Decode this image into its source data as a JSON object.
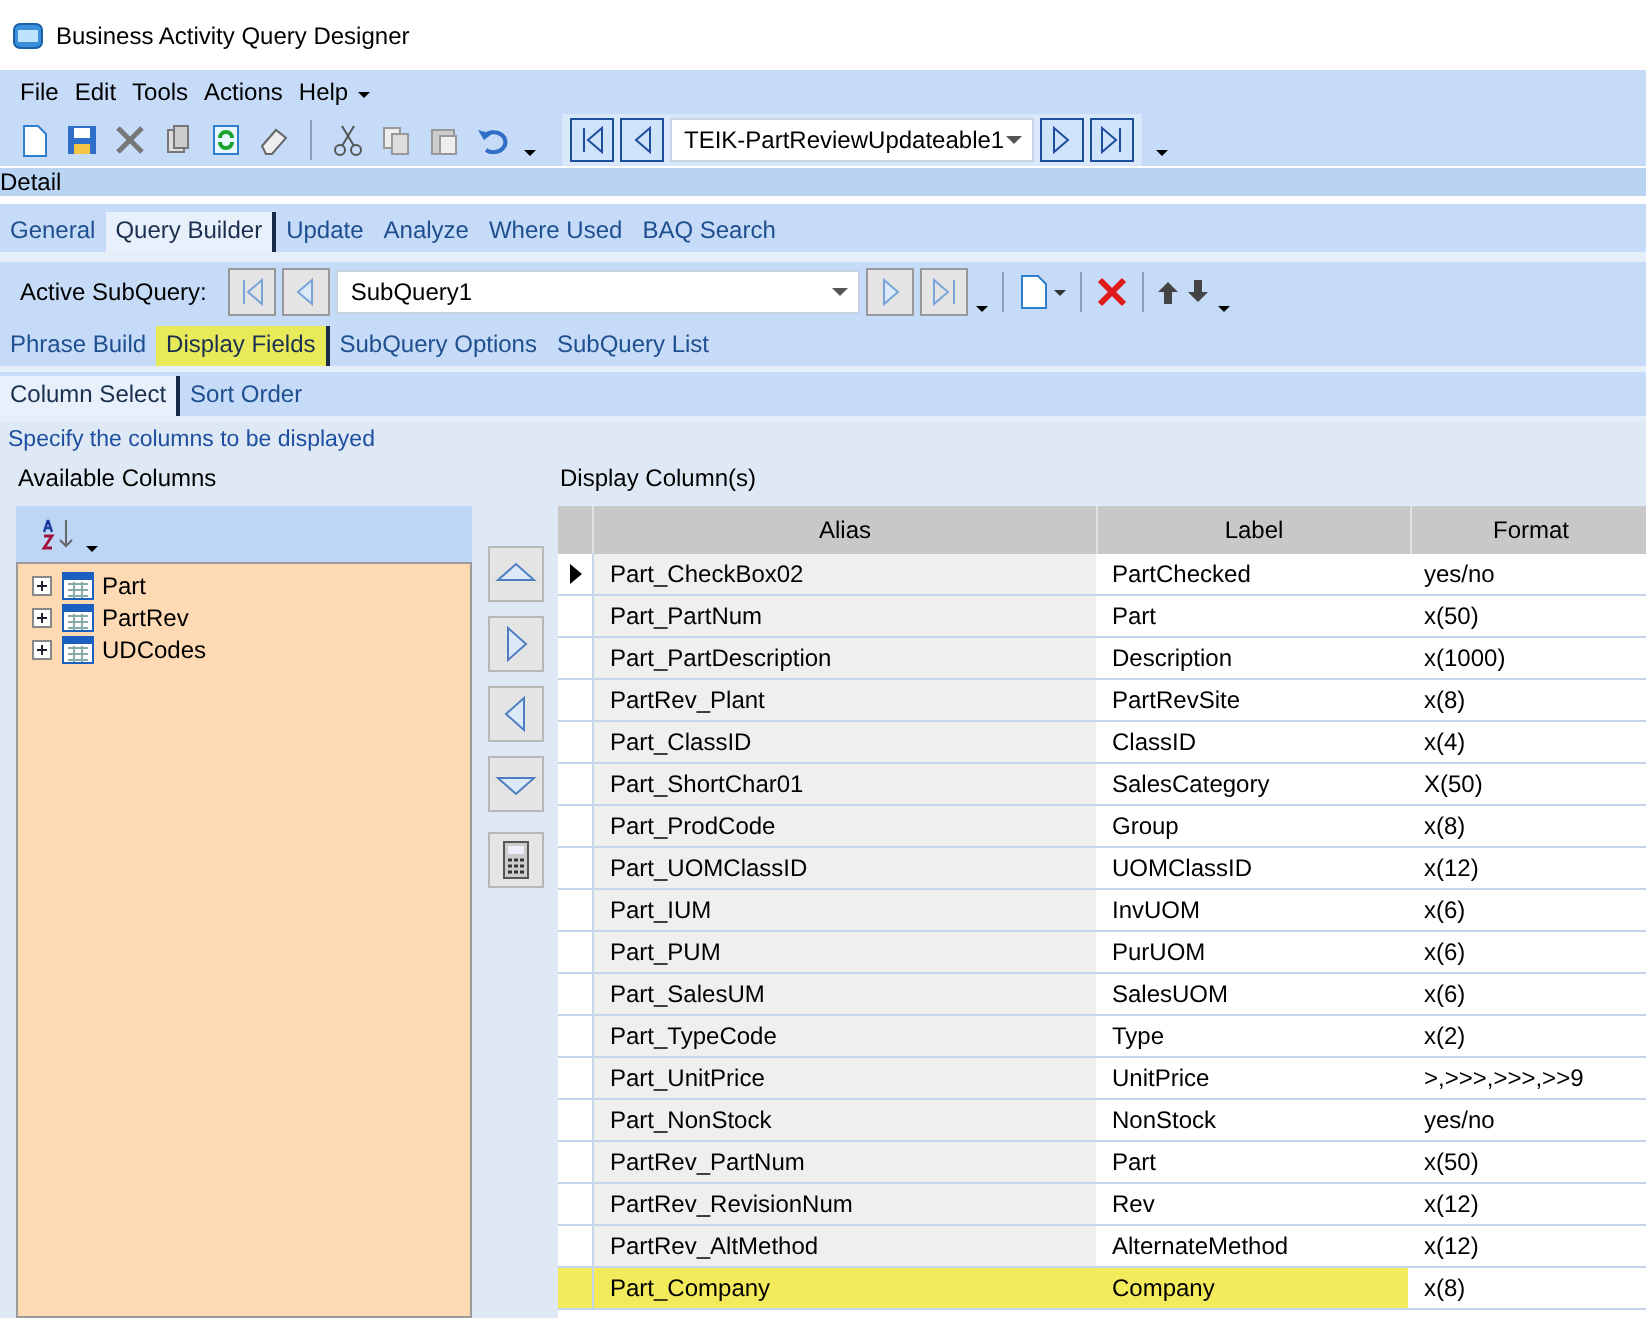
{
  "window": {
    "title": "Business Activity Query Designer"
  },
  "menu": [
    "File",
    "Edit",
    "Tools",
    "Actions",
    "Help"
  ],
  "toolbar": {
    "query_id": "TEIK-PartReviewUpdateable1"
  },
  "section_label": "Detail",
  "main_tabs": [
    {
      "label": "General",
      "selected": false
    },
    {
      "label": "Query Builder",
      "selected": true
    },
    {
      "label": "Update",
      "selected": false
    },
    {
      "label": "Analyze",
      "selected": false
    },
    {
      "label": "Where Used",
      "selected": false
    },
    {
      "label": "BAQ Search",
      "selected": false
    }
  ],
  "subquery_bar": {
    "label": "Active SubQuery:",
    "value": "SubQuery1"
  },
  "builder_tabs": [
    {
      "label": "Phrase Build",
      "selected": false,
      "highlighted": false
    },
    {
      "label": "Display Fields",
      "selected": true,
      "highlighted": true
    },
    {
      "label": "SubQuery Options",
      "selected": false,
      "highlighted": false
    },
    {
      "label": "SubQuery List",
      "selected": false,
      "highlighted": false
    }
  ],
  "field_tabs": [
    {
      "label": "Column Select",
      "selected": true
    },
    {
      "label": "Sort Order",
      "selected": false
    }
  ],
  "hint": "Specify the columns to be displayed",
  "available": {
    "title": "Available Columns",
    "tables": [
      {
        "name": "Part",
        "expanded": false
      },
      {
        "name": "PartRev",
        "expanded": false
      },
      {
        "name": "UDCodes",
        "expanded": false
      }
    ]
  },
  "display": {
    "title": "Display Column(s)",
    "columns": [
      "Alias",
      "Label",
      "Format"
    ],
    "rows": [
      {
        "alias": "Part_CheckBox02",
        "label": "PartChecked",
        "format": "yes/no",
        "current": true,
        "highlighted": false
      },
      {
        "alias": "Part_PartNum",
        "label": "Part",
        "format": "x(50)",
        "current": false,
        "highlighted": false
      },
      {
        "alias": "Part_PartDescription",
        "label": "Description",
        "format": "x(1000)",
        "current": false,
        "highlighted": false
      },
      {
        "alias": "PartRev_Plant",
        "label": "PartRevSite",
        "format": "x(8)",
        "current": false,
        "highlighted": false
      },
      {
        "alias": "Part_ClassID",
        "label": "ClassID",
        "format": "x(4)",
        "current": false,
        "highlighted": false
      },
      {
        "alias": "Part_ShortChar01",
        "label": "SalesCategory",
        "format": "X(50)",
        "current": false,
        "highlighted": false
      },
      {
        "alias": "Part_ProdCode",
        "label": "Group",
        "format": "x(8)",
        "current": false,
        "highlighted": false
      },
      {
        "alias": "Part_UOMClassID",
        "label": "UOMClassID",
        "format": "x(12)",
        "current": false,
        "highlighted": false
      },
      {
        "alias": "Part_IUM",
        "label": "InvUOM",
        "format": "x(6)",
        "current": false,
        "highlighted": false
      },
      {
        "alias": "Part_PUM",
        "label": "PurUOM",
        "format": "x(6)",
        "current": false,
        "highlighted": false
      },
      {
        "alias": "Part_SalesUM",
        "label": "SalesUOM",
        "format": "x(6)",
        "current": false,
        "highlighted": false
      },
      {
        "alias": "Part_TypeCode",
        "label": "Type",
        "format": "x(2)",
        "current": false,
        "highlighted": false
      },
      {
        "alias": "Part_UnitPrice",
        "label": "UnitPrice",
        "format": ">,>>>,>>>,>>9",
        "current": false,
        "highlighted": false
      },
      {
        "alias": "Part_NonStock",
        "label": "NonStock",
        "format": "yes/no",
        "current": false,
        "highlighted": false
      },
      {
        "alias": "PartRev_PartNum",
        "label": "Part",
        "format": "x(50)",
        "current": false,
        "highlighted": false
      },
      {
        "alias": "PartRev_RevisionNum",
        "label": "Rev",
        "format": "x(12)",
        "current": false,
        "highlighted": false
      },
      {
        "alias": "PartRev_AltMethod",
        "label": "AlternateMethod",
        "format": "x(12)",
        "current": false,
        "highlighted": false
      },
      {
        "alias": "Part_Company",
        "label": "Company",
        "format": "x(8)",
        "current": false,
        "highlighted": true
      }
    ]
  }
}
